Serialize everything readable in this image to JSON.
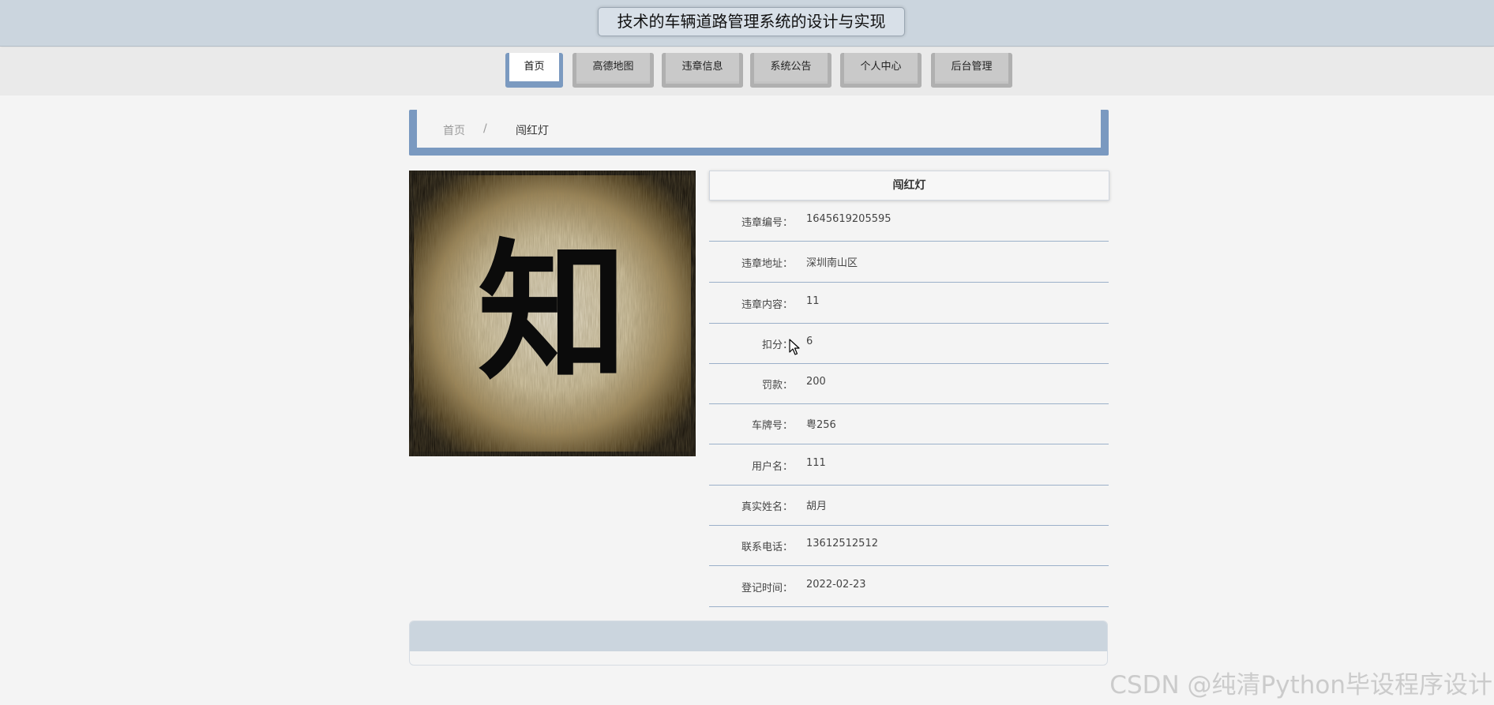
{
  "header": {
    "title": "技术的车辆道路管理系统的设计与实现"
  },
  "nav": {
    "items": [
      {
        "label": "首页",
        "active": true
      },
      {
        "label": "高德地图"
      },
      {
        "label": "违章信息"
      },
      {
        "label": "系统公告"
      },
      {
        "label": "个人中心"
      },
      {
        "label": "后台管理"
      }
    ]
  },
  "breadcrumb": {
    "home": "首页",
    "separator": "/",
    "current": "闯红灯"
  },
  "detail": {
    "title": "闯红灯",
    "rows": [
      {
        "label": "违章编号：",
        "value": "1645619205595"
      },
      {
        "label": "违章地址：",
        "value": "深圳南山区"
      },
      {
        "label": "违章内容：",
        "value": "11"
      },
      {
        "label": "扣分：",
        "value": "6"
      },
      {
        "label": "罚款：",
        "value": "200"
      },
      {
        "label": "车牌号：",
        "value": "粤256"
      },
      {
        "label": "用户名：",
        "value": "111"
      },
      {
        "label": "真实姓名：",
        "value": "胡月"
      },
      {
        "label": "联系电话：",
        "value": "13612512512"
      },
      {
        "label": "登记时间：",
        "value": "2022-02-23"
      }
    ]
  },
  "image": {
    "glyph": "知"
  },
  "watermark": "CSDN @纯清Python毕设程序设计",
  "colors": {
    "accent": "#7a99c0",
    "header_bg": "#cbd5de",
    "nav_inactive": "#c3c3c3",
    "row_divider": "#9bb0c9"
  }
}
